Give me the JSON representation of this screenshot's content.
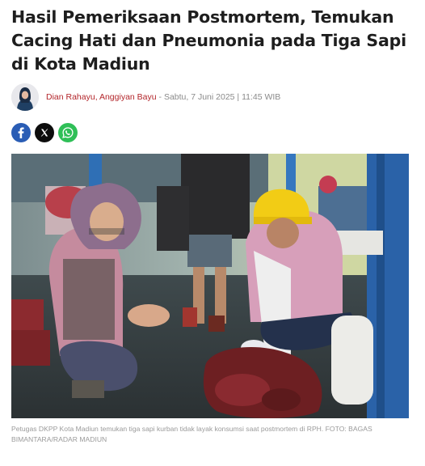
{
  "article": {
    "title": "Hasil Pemeriksaan Postmortem, Temukan Cacing Hati dan Pneumonia pada Tiga Sapi di Kota Madiun",
    "authors": "Dian Rahayu, Anggiyan Bayu",
    "separator": " - ",
    "date": "Sabtu, 7 Juni 2025 | 11:45 WIB",
    "photo_alt_label": "",
    "caption": "Petugas DKPP Kota Madiun temukan tiga sapi kurban tidak layak konsumsi saat postmortem di RPH. FOTO: BAGAS BIMANTARA/RADAR MADIUN"
  },
  "share": {
    "buttons": [
      {
        "name": "facebook",
        "icon": "facebook-icon",
        "color": "#2a5db5"
      },
      {
        "name": "x",
        "icon": "x-icon",
        "color": "#0d0d0d"
      },
      {
        "name": "whatsapp",
        "icon": "whatsapp-icon",
        "color": "#2fbf57"
      }
    ]
  },
  "colors": {
    "author_link": "#b3262b",
    "meta_text": "#8a8a8a",
    "caption_text": "#9a9a9a"
  }
}
